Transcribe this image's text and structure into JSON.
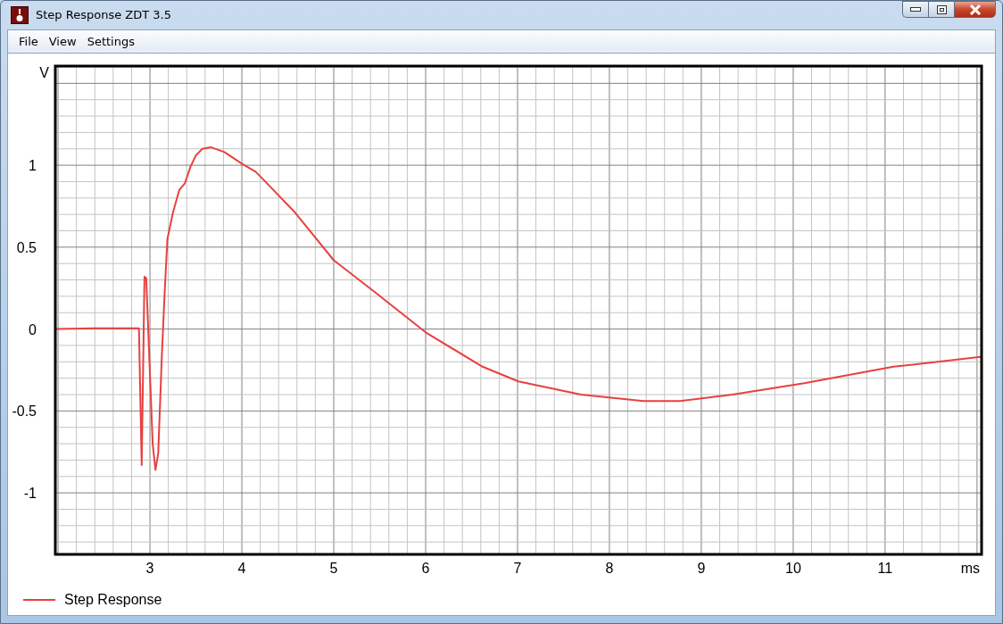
{
  "window": {
    "title": "Step Response ZDT 3.5"
  },
  "menu": [
    {
      "label": "File"
    },
    {
      "label": "View"
    },
    {
      "label": "Settings"
    }
  ],
  "chart_data": {
    "type": "line",
    "grid": true,
    "xlabel": "ms",
    "ylabel": "V",
    "xlim": [
      1.98,
      12.04
    ],
    "ylim": [
      -1.37,
      1.6
    ],
    "xticks": [
      3,
      4,
      5,
      6,
      7,
      8,
      9,
      10,
      11
    ],
    "yticks": [
      -1,
      -0.5,
      0,
      0.5,
      1
    ],
    "x": [
      1.98,
      2.4,
      2.88,
      2.91,
      2.94,
      2.96,
      2.99,
      3.03,
      3.06,
      3.09,
      3.13,
      3.16,
      3.19,
      3.25,
      3.32,
      3.38,
      3.44,
      3.5,
      3.57,
      3.66,
      3.81,
      4.0,
      4.15,
      4.29,
      4.58,
      5.0,
      5.46,
      6.0,
      6.62,
      7.01,
      7.69,
      8.37,
      8.76,
      9.34,
      10.12,
      11.09,
      12.04
    ],
    "series": [
      {
        "name": "Step Response",
        "color": "#e84040",
        "values": [
          0,
          0.005,
          0.005,
          -0.83,
          0.32,
          0.31,
          -0.13,
          -0.7,
          -0.86,
          -0.76,
          -0.16,
          0.22,
          0.55,
          0.71,
          0.85,
          0.89,
          0.99,
          1.06,
          1.1,
          1.11,
          1.08,
          1.01,
          0.96,
          0.88,
          0.71,
          0.42,
          0.22,
          -0.02,
          -0.23,
          -0.32,
          -0.4,
          -0.44,
          -0.44,
          -0.4,
          -0.33,
          -0.23,
          -0.17
        ]
      }
    ]
  }
}
